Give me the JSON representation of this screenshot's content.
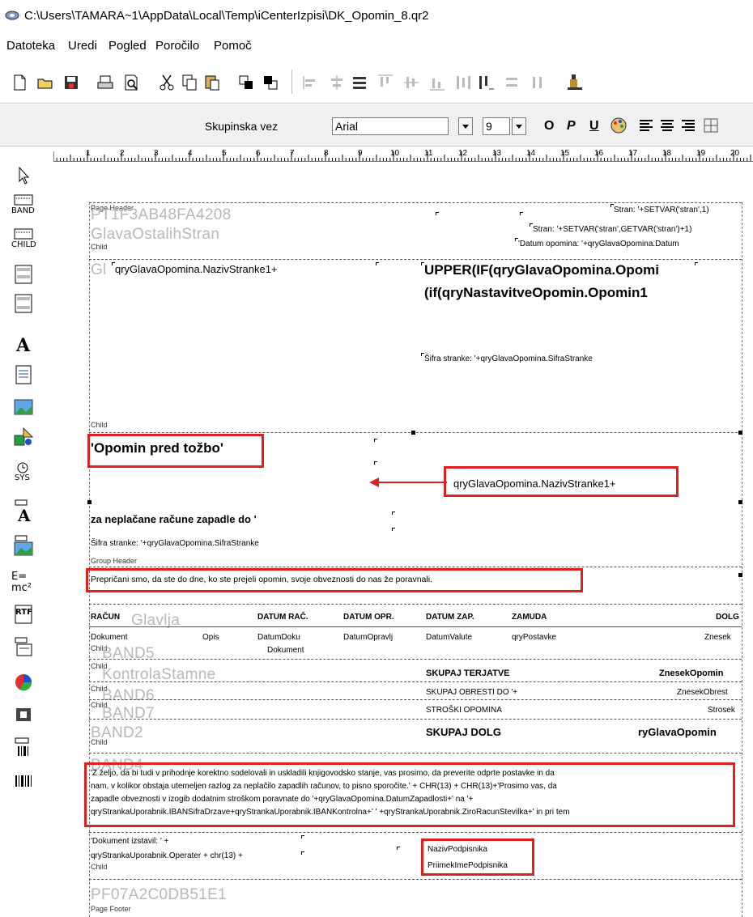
{
  "window": {
    "title": "C:\\Users\\TAMARA~1\\AppData\\Local\\Temp\\iCenterIzpisi\\DK_Opomin_8.qr2"
  },
  "menu": [
    "Datoteka",
    "Uredi",
    "Pogled",
    "Poročilo",
    "Pomoč"
  ],
  "toolbar2": {
    "group_button": "Skupinska vez",
    "font": "Arial",
    "font_size": "9",
    "bold": "O",
    "italic": "P",
    "underline": "U"
  },
  "ruler": [
    "1",
    "2",
    "3",
    "4",
    "5",
    "6",
    "7",
    "8",
    "9",
    "10",
    "11",
    "12",
    "13",
    "14",
    "15",
    "16",
    "17",
    "18",
    "19",
    "20"
  ],
  "palette": {
    "band": "BAND",
    "child": "CHILD",
    "sys": "SYS",
    "formula": "E=",
    "formula2": "mc²",
    "rtf": "RTF"
  },
  "bands": {
    "page_header": {
      "band_label": "Page Header",
      "band_name": "PT1F3AB48FA4208",
      "field1": "Stran: '+SETVAR('stran',1)"
    },
    "child1": {
      "band_name": "GlavaOstalihStran",
      "child_label": "Child",
      "field1": "Stran: '+SETVAR('stran',GETVAR('stran')+1)",
      "field2": "'Datum opomina: '+qryGlavaOpomina.Datum"
    },
    "glava": {
      "band_name_prefix": "Gl",
      "naziv": "qryGlavaOpomina.NazivStranke1+",
      "upper1": "UPPER(IF(qryGlavaOpomina.Opomi",
      "upper2": "(if(qryNastavitveOpomin.Opomin1",
      "sifra": "Šifra stranke: '+qryGlavaOpomina.SifraStranke",
      "child_label": "Child"
    },
    "opomin": {
      "title": "'Opomin pred tožbo'",
      "naziv": "qryGlavaOpomina.NazivStranke1+",
      "za_neplacane": "za neplačane račune zapadle do '",
      "sifra": "Šifra stranke: '+qryGlavaOpomina.SifraStranke",
      "group_label": "Group Header"
    },
    "preprican": {
      "text": "Prepričani smo, da ste do dne, ko ste prejeli opomin, svoje obveznosti do nas že poravnali."
    },
    "columns": {
      "band_name": "Glavlja",
      "headers": [
        "RAČUN",
        "DATUM RAČ.",
        "DATUM OPR.",
        "DATUM ZAP.",
        "ZAMUDA",
        "DOLG"
      ],
      "row": [
        "Dokument",
        "Opis",
        "DatumDoku",
        "DatumOpravlj",
        "DatumValute",
        "qryPostavke",
        "Znesek"
      ],
      "row2": "Dokument",
      "child_label": "Child",
      "band5": "BAND5"
    },
    "totals": {
      "band_kontrola": "KontrolaStamne",
      "band6": "BAND6",
      "band7": "BAND7",
      "band2": "BAND2",
      "child_label": "Child",
      "skupaj_terjatve": "SKUPAJ TERJATVE",
      "znesek_opomin": "ZnesekOpomin",
      "skupaj_obresti": "SKUPAJ OBRESTI DO '+",
      "znesek_obresti": "ZnesekObrest",
      "stroski": "STROŠKI OPOMINA",
      "strosek": "Strosek",
      "skupaj_dolg": "SKUPAJ DOLG",
      "glava_opomin": "ryGlavaOpomin"
    },
    "band4": {
      "band_name": "BAND4",
      "lines": [
        "'Z željo, da bi tudi v prihodnje korektno sodelovali in uskladili knjigovodsko stanje, vas prosimo, da preverite odprte postavke in da",
        "nam, v kolikor obstaja utemeljen razlog za neplačilo zapadlih računov, to pisno sporočite.' + CHR(13) + CHR(13)+'Prosimo vas, da",
        "zapadle obveznosti v izogib dodatnim stroškom poravnate do '+qryGlavaOpomina.DatumZapadlosti+' na '+",
        "qryStrankaUporabnik.IBANSifraDrzave+qryStrankaUporabnik.IBANKontrolna+' ' +qryStrankaUporabnik.ZiroRacunStevilka+' in pri tem"
      ]
    },
    "signature": {
      "izstavil1": "'Dokument izstavil: ' +",
      "izstavil2": "qryStrankaUporabnik.Operater + chr(13) +",
      "child_label": "Child",
      "naziv": "NazivPodpisnika",
      "priimek": "PriimekImePodpisnika"
    },
    "footer": {
      "band_name": "PF07A2C0DB51E1",
      "label": "Page Footer"
    }
  },
  "colors": {
    "highlight": "#e02020",
    "band_name": "#b8b8b8"
  }
}
